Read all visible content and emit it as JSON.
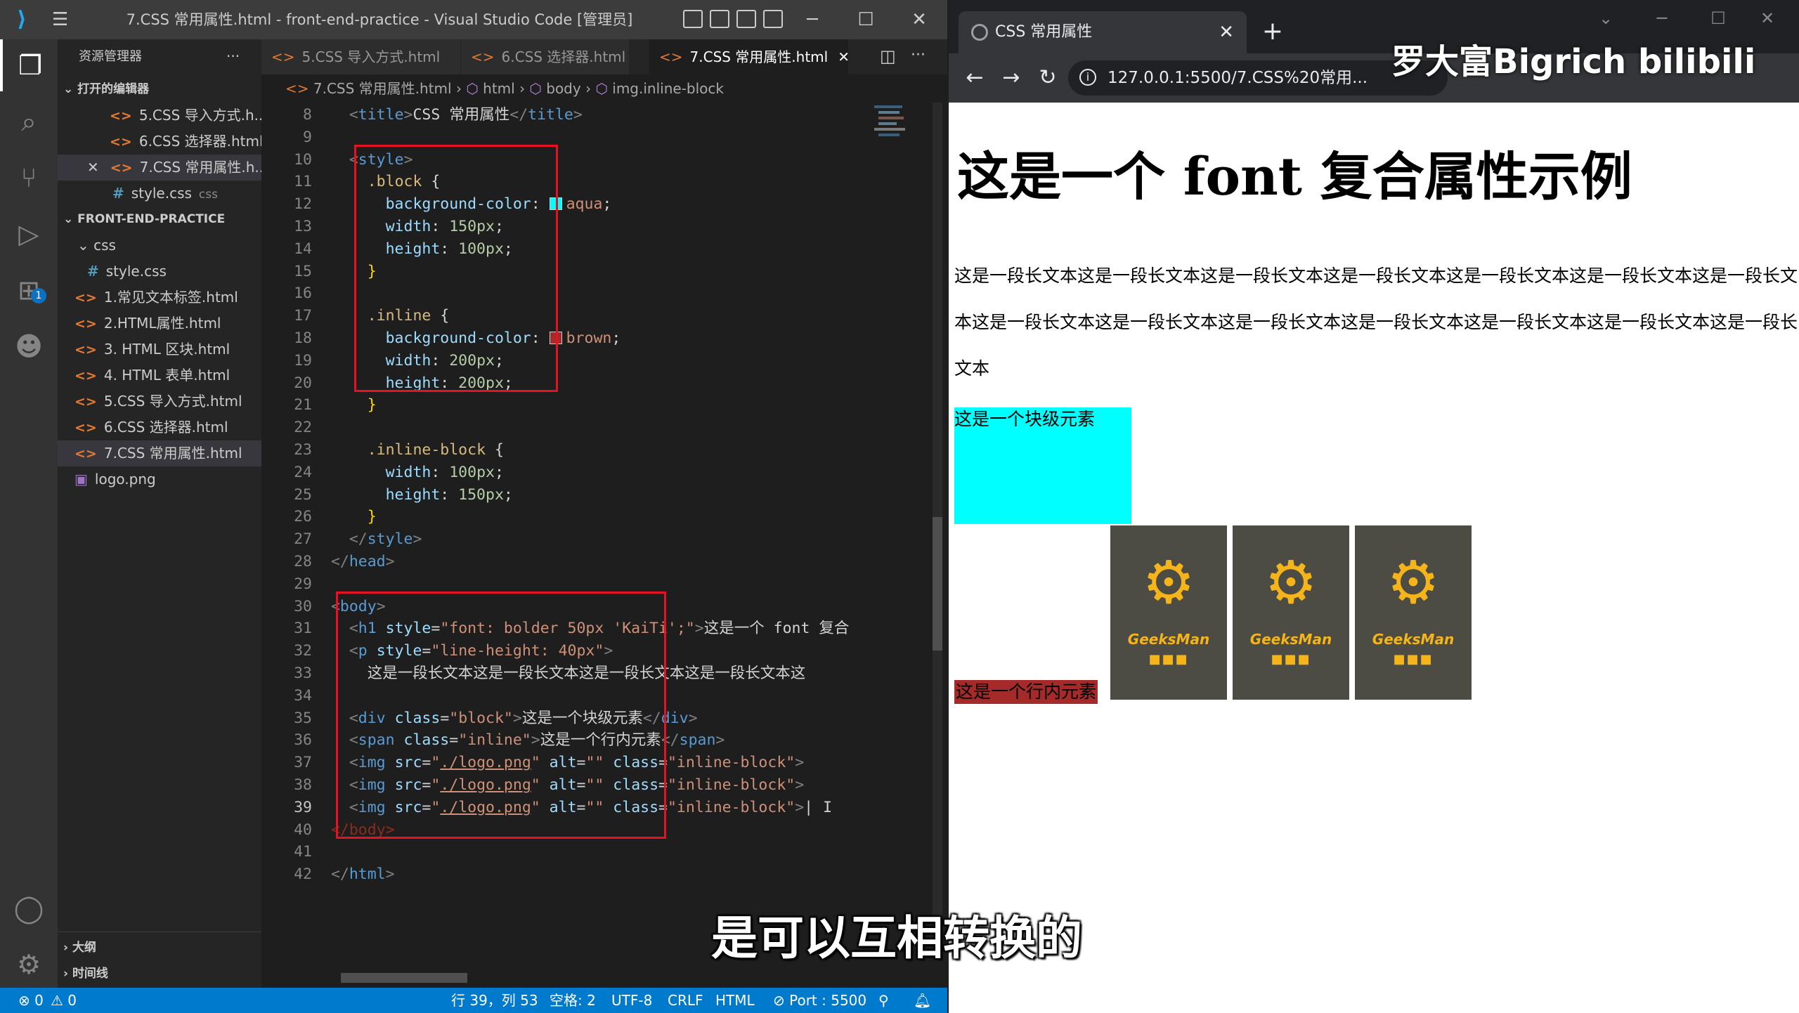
{
  "vscode": {
    "window_title": "7.CSS 常用属性.html - front-end-practice - Visual Studio Code [管理员]",
    "sidebar": {
      "title": "资源管理器",
      "more": "···",
      "open_editors_label": "打开的编辑器",
      "open_editors": [
        {
          "name": "5.CSS 导入方式.h..."
        },
        {
          "name": "6.CSS 选择器.html"
        },
        {
          "name": "7.CSS 常用属性.h..."
        },
        {
          "name": "style.css",
          "detail": "css"
        }
      ],
      "project_label": "FRONT-END-PRACTICE",
      "folder": "css",
      "files": [
        "style.css",
        "1.常见文本标签.html",
        "2.HTML属性.html",
        "3. HTML 区块.html",
        "4. HTML 表单.html",
        "5.CSS 导入方式.html",
        "6.CSS 选择器.html",
        "7.CSS 常用属性.html",
        "logo.png"
      ],
      "outline_label": "大纲",
      "timeline_label": "时间线"
    },
    "tabs": [
      {
        "label": "5.CSS 导入方式.html"
      },
      {
        "label": "6.CSS 选择器.html"
      },
      {
        "label": "7.CSS 常用属性.html",
        "close": "✕"
      }
    ],
    "breadcrumb": {
      "file": "7.CSS 常用属性.html",
      "html": "html",
      "body": "body",
      "element": "img.inline-block"
    },
    "code_lines": [
      {
        "n": "8",
        "text": "<title>CSS 常用属性</title>"
      },
      {
        "n": "9",
        "text": ""
      },
      {
        "n": "10",
        "text": "<style>"
      },
      {
        "n": "11",
        "text": ".block {"
      },
      {
        "n": "12",
        "text": "background-color: aqua;"
      },
      {
        "n": "13",
        "text": "width: 150px;"
      },
      {
        "n": "14",
        "text": "height: 100px;"
      },
      {
        "n": "15",
        "text": "}"
      },
      {
        "n": "16",
        "text": ""
      },
      {
        "n": "17",
        "text": ".inline {"
      },
      {
        "n": "18",
        "text": "background-color: brown;"
      },
      {
        "n": "19",
        "text": "width: 200px;"
      },
      {
        "n": "20",
        "text": "height: 200px;"
      },
      {
        "n": "21",
        "text": "}"
      },
      {
        "n": "22",
        "text": ""
      },
      {
        "n": "23",
        "text": ".inline-block {"
      },
      {
        "n": "24",
        "text": "width: 100px;"
      },
      {
        "n": "25",
        "text": "height: 150px;"
      },
      {
        "n": "26",
        "text": "}"
      },
      {
        "n": "27",
        "text": "</style>"
      },
      {
        "n": "28",
        "text": "</head>"
      },
      {
        "n": "29",
        "text": ""
      },
      {
        "n": "30",
        "text": "<body>"
      },
      {
        "n": "31",
        "text": "<h1 style=\"font: bolder 50px 'KaiTi';\">这是一个 font 复合"
      },
      {
        "n": "32",
        "text": "<p style=\"line-height: 40px\">"
      },
      {
        "n": "33",
        "text": "这是一段长文本这是一段长文本这是一段长文本这是一段长文本这"
      },
      {
        "n": "34",
        "text": ""
      },
      {
        "n": "35",
        "text": "<div class=\"block\">这是一个块级元素</div>"
      },
      {
        "n": "36",
        "text": "<span class=\"inline\">这是一个行内元素</span>"
      },
      {
        "n": "37",
        "text": "<img src=\"./logo.png\" alt=\"\" class=\"inline-block\">"
      },
      {
        "n": "38",
        "text": "<img src=\"./logo.png\" alt=\"\" class=\"inline-block\">"
      },
      {
        "n": "39",
        "text": "<img src=\"./logo.png\" alt=\"\" class=\"inline-block\">"
      },
      {
        "n": "40",
        "text": "</body>"
      },
      {
        "n": "41",
        "text": ""
      },
      {
        "n": "42",
        "text": "</html>"
      }
    ],
    "statusbar": {
      "errors": "⊗ 0",
      "warnings": "⚠ 0",
      "position": "行 39，列 53",
      "spaces": "空格: 2",
      "encoding": "UTF-8",
      "eol": "CRLF",
      "language": "HTML",
      "port": "⊘ Port : 5500"
    }
  },
  "browser": {
    "tab_title": "CSS 常用属性",
    "tab_close": "✕",
    "new_tab": "+",
    "url": "127.0.0.1:5500/7.CSS%20常用...",
    "watermark": "罗大富Bigrich bilibili",
    "page": {
      "h1": "这是一个 font 复合属性示例",
      "paragraph": "这是一段长文本这是一段长文本这是一段长文本这是一段长文本这是一段长文本这是一段长文本这是一段长文本这是一段长文本这是一段长文本这是一段长文本这是一段长文本这是一段长文本这是一段长文本这是一段长文本",
      "block_text": "这是一个块级元素",
      "inline_text": "这是一个行内元素",
      "logo_brand": "GeeksMan",
      "logo_dots": "■■■",
      "logo_count": 3
    }
  },
  "subtitle": "是可以互相转换的",
  "colors": {
    "accent": "#007acc",
    "highlight_box": "#e81123",
    "aqua": "#00ffff",
    "brown": "#a52a2a",
    "logo_gold": "#f4b41a"
  }
}
